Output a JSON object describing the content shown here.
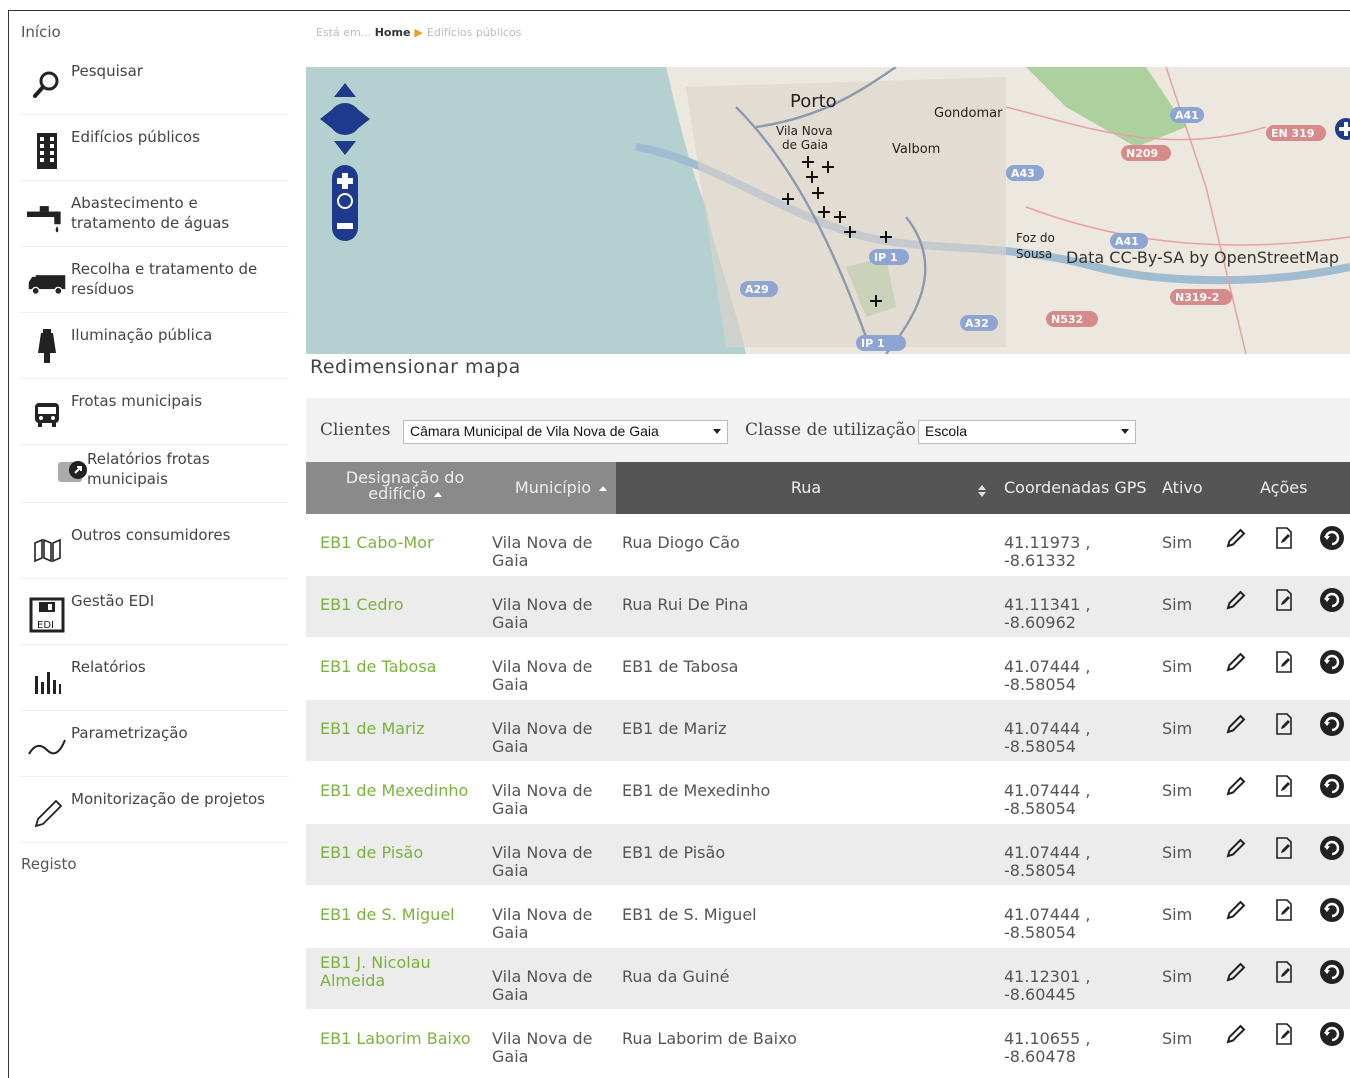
{
  "sidebar": {
    "top_link": "Início",
    "items": [
      {
        "label": "Pesquisar",
        "icon": "search-icon"
      },
      {
        "label": "Edifícios públicos",
        "icon": "building-icon"
      },
      {
        "label": "Abastecimento e tratamento de águas",
        "icon": "faucet-icon"
      },
      {
        "label": "Recolha e tratamento de resíduos",
        "icon": "truck-icon"
      },
      {
        "label": "Iluminação pública",
        "icon": "lamp-icon"
      },
      {
        "label": "Frotas municipais",
        "icon": "bus-icon"
      },
      {
        "label": "Relatórios frotas municipais",
        "icon": "fleet-report-icon"
      },
      {
        "label": "Outros consumidores",
        "icon": "consumers-icon"
      },
      {
        "label": "Gestão EDI",
        "icon": "floppy-icon"
      },
      {
        "label": "Relatórios",
        "icon": "bar-chart-icon"
      },
      {
        "label": "Parametrização",
        "icon": "wave-icon"
      },
      {
        "label": "Monitorização de projetos",
        "icon": "pencil-icon"
      }
    ],
    "bottom_link": "Registo"
  },
  "breadcrumb": {
    "prefix": "Está em...",
    "home": "Home",
    "current": "Edifícios públicos"
  },
  "map": {
    "labels": [
      "Porto",
      "Gondomar",
      "Vila Nova de Gaia",
      "Valbom",
      "Foz do Sousa",
      "Data CC-By-SA by OpenStreetMap"
    ],
    "road_labels": [
      "A41",
      "EN 319",
      "N209",
      "A43",
      "A41",
      "IP 1",
      "A29",
      "A32",
      "N532",
      "N319-2",
      "IP 1"
    ],
    "resize_label": "Redimensionar mapa"
  },
  "filters": {
    "clientes_label": "Clientes",
    "clientes_value": "Câmara Municipal de Vila Nova de Gaia",
    "classe_label": "Classe de utilização",
    "classe_value": "Escola"
  },
  "table": {
    "headers": [
      "Designação do edifício",
      "Município",
      "Rua",
      "Coordenadas GPS",
      "Ativo",
      "Ações"
    ],
    "rows": [
      {
        "name": "EB1 Cabo-Mor",
        "municipio": "Vila Nova de Gaia",
        "rua": "Rua Diogo Cão",
        "gps": "41.11973 , -8.61332",
        "ativo": "Sim"
      },
      {
        "name": "EB1 Cedro",
        "municipio": "Vila Nova de Gaia",
        "rua": "Rua Rui De Pina",
        "gps": "41.11341 , -8.60962",
        "ativo": "Sim"
      },
      {
        "name": "EB1 de Tabosa",
        "municipio": "Vila Nova de Gaia",
        "rua": "EB1 de Tabosa",
        "gps": "41.07444 , -8.58054",
        "ativo": "Sim"
      },
      {
        "name": "EB1 de Mariz",
        "municipio": "Vila Nova de Gaia",
        "rua": "EB1 de Mariz",
        "gps": "41.07444 , -8.58054",
        "ativo": "Sim"
      },
      {
        "name": "EB1 de Mexedinho",
        "municipio": "Vila Nova de Gaia",
        "rua": "EB1 de Mexedinho",
        "gps": "41.07444 , -8.58054",
        "ativo": "Sim"
      },
      {
        "name": "EB1 de Pisão",
        "municipio": "Vila Nova de Gaia",
        "rua": "EB1 de Pisão",
        "gps": "41.07444 , -8.58054",
        "ativo": "Sim"
      },
      {
        "name": "EB1 de S. Miguel",
        "municipio": "Vila Nova de Gaia",
        "rua": "EB1 de S. Miguel",
        "gps": "41.07444 , -8.58054",
        "ativo": "Sim"
      },
      {
        "name": "EB1 J. Nicolau Almeida",
        "municipio": "Vila Nova de Gaia",
        "rua": "Rua da Guiné",
        "gps": "41.12301 , -8.60445",
        "ativo": "Sim"
      },
      {
        "name": "EB1 Laborim Baixo",
        "municipio": "Vila Nova de Gaia",
        "rua": "Rua Laborim de Baixo",
        "gps": "41.10655 , -8.60478",
        "ativo": "Sim"
      }
    ]
  },
  "colors": {
    "link_green": "#7ab33b",
    "header_dark": "#555555",
    "nav_blue": "#1e3a8c"
  }
}
